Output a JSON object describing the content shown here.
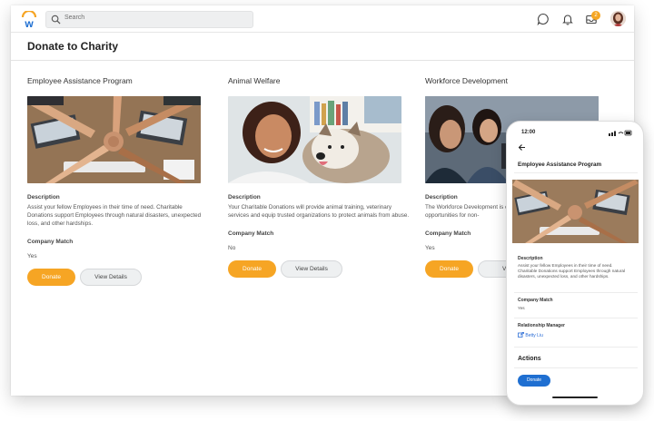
{
  "header": {
    "search_placeholder": "Search",
    "notification_count": "2",
    "icons": [
      "workday-logo-icon",
      "search-icon",
      "chat-icon",
      "bell-icon",
      "inbox-icon",
      "avatar"
    ]
  },
  "page": {
    "title": "Donate to Charity"
  },
  "cards": [
    {
      "title": "Employee Assistance Program",
      "description_label": "Description",
      "description": "Assist your fellow Employees in their time of need. Charitable Donations support Employees through natural disasters, unexpected loss, and other hardships.",
      "match_label": "Company Match",
      "match_value": "Yes",
      "donate_label": "Donate",
      "view_label": "View Details"
    },
    {
      "title": "Animal Welfare",
      "description_label": "Description",
      "description": "Your Charitable Donations will provide animal training, veterinary services and equip trusted organizations to protect animals from abuse.",
      "match_label": "Company Match",
      "match_value": "No",
      "donate_label": "Donate",
      "view_label": "View Details"
    },
    {
      "title": "Workforce Development",
      "description_label": "Description",
      "description": "The Workforce Development is designed to provide training and job opportunities for non-",
      "match_label": "Company Match",
      "match_value": "Yes",
      "donate_label": "Donate",
      "view_label": "View"
    }
  ],
  "phone": {
    "time": "12:00",
    "title": "Employee Assistance Program",
    "description_label": "Description",
    "description": "Assist your fellow Employees in their time of need. Charitable Donations support Employees through natural disasters, unexpected loss, and other hardships.",
    "match_label": "Company Match",
    "match_value": "Yes",
    "manager_label": "Relationship Manager",
    "manager_name": "Betty Liu",
    "actions_label": "Actions",
    "donate_label": "Donate"
  },
  "colors": {
    "accent_orange": "#f6a524",
    "phone_button_blue": "#1f6fd1",
    "link_blue": "#2b6dd6",
    "logo_blue": "#1f6fd1",
    "logo_orange": "#f6a524"
  }
}
